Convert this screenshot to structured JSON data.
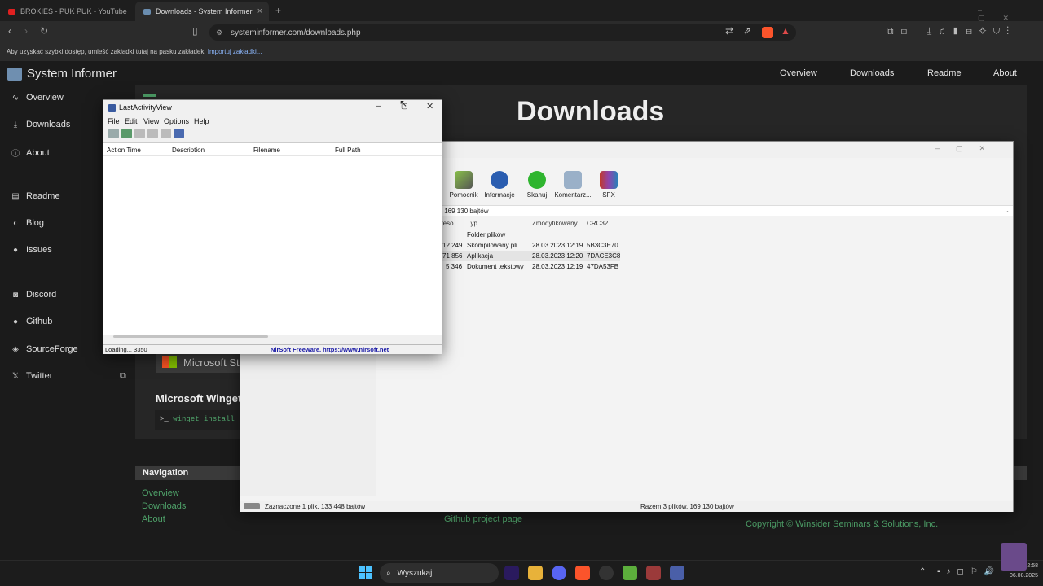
{
  "browser": {
    "tabs": [
      {
        "title": "BROKIES - PUK PUK - YouTube",
        "active": false
      },
      {
        "title": "Downloads - System Informer",
        "active": true
      }
    ],
    "new_tab": "+",
    "url": "systeminformer.com/downloads.php",
    "bookmarks_hint": "Aby uzyskać szybki dostęp, umieść zakładki tutaj na pasku zakładek.",
    "bookmarks_import": "Importuj zakładki..."
  },
  "site": {
    "logo": "System Informer",
    "top_nav": [
      "Overview",
      "Downloads",
      "Readme",
      "About"
    ],
    "sidebar": [
      {
        "label": "Overview",
        "icon": "activity-icon"
      },
      {
        "label": "Downloads",
        "icon": "download-icon"
      },
      {
        "label": "About",
        "icon": "info-icon"
      },
      {
        "label": "Readme",
        "icon": "book-icon"
      },
      {
        "label": "Blog",
        "icon": "shield-icon"
      },
      {
        "label": "Issues",
        "icon": "github-icon"
      },
      {
        "label": "Discord",
        "icon": "discord-icon"
      },
      {
        "label": "Github",
        "icon": "github-icon"
      },
      {
        "label": "SourceForge",
        "icon": "sourceforge-icon"
      },
      {
        "label": "Twitter",
        "icon": "x-icon"
      }
    ],
    "heading": "Downloads",
    "store_label": "Microsoft St",
    "winget_title": "Microsoft Winget",
    "winget_cmd": "winget install",
    "winget_prompt": ">_",
    "bottom_nav_title": "Navigation",
    "bottom_nav_links": [
      "Overview",
      "Downloads",
      "About"
    ],
    "github_page": "Github project page",
    "copyright": "Copyright © Winsider Seminars & Solutions, Inc."
  },
  "archive": {
    "tools": [
      "Pomocnik",
      "Informacje",
      "Skanuj",
      "Komentarz...",
      "SFX"
    ],
    "path": "y 169 130 bajtów",
    "columns": [
      "reso...",
      "Typ",
      "Zmodyfikowany",
      "CRC32"
    ],
    "rows": [
      {
        "size": "",
        "type": "Folder plików",
        "modified": "",
        "crc": ""
      },
      {
        "size": "12 249",
        "type": "Skompilowany pli...",
        "modified": "28.03.2023 12:19",
        "crc": "5B3C3E70"
      },
      {
        "size": "71 856",
        "type": "Aplikacja",
        "modified": "28.03.2023 12:20",
        "crc": "7DACE3C8"
      },
      {
        "size": "5 346",
        "type": "Dokument tekstowy",
        "modified": "28.03.2023 12:19",
        "crc": "47DA53FB"
      }
    ],
    "status_left": "Zaznaczone 1 plik, 133 448 bajtów",
    "status_right": "Razem 3 plików, 169 130 bajtów"
  },
  "lav": {
    "title": "LastActivityView",
    "menu": [
      "File",
      "Edit",
      "View",
      "Options",
      "Help"
    ],
    "columns": [
      "Action Time",
      "Description",
      "Filename",
      "Full Path"
    ],
    "status_left": "Loading... 3350",
    "status_right": "NirSoft Freeware. https://www.nirsoft.net"
  },
  "taskbar": {
    "search": "Wyszukaj",
    "date": "06.08.2025",
    "time": "12:58"
  },
  "colors": {
    "accent_green": "#4fa36a",
    "link_blue": "#1a1aa6"
  }
}
